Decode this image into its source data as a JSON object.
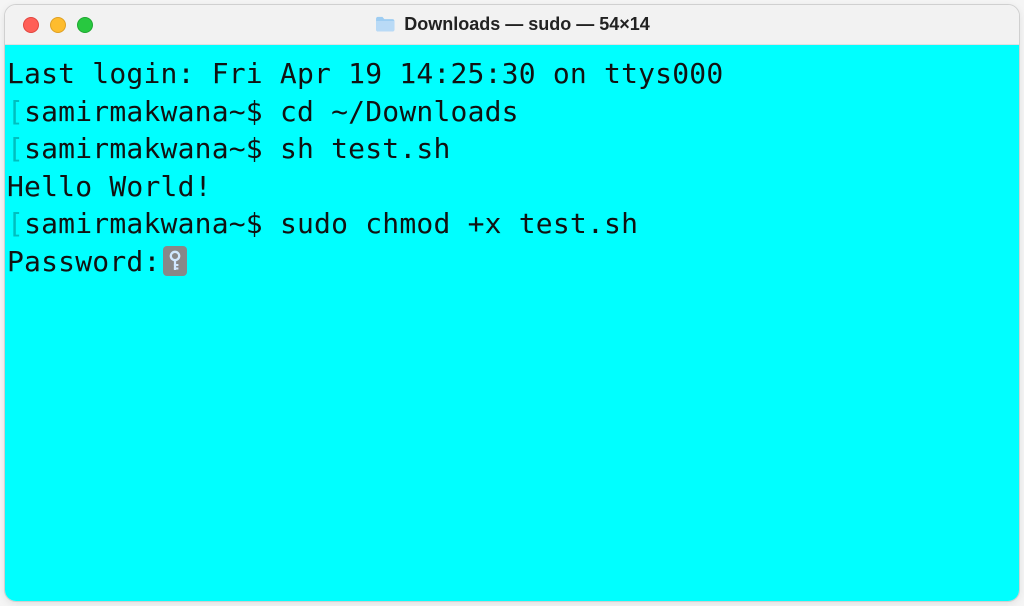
{
  "window": {
    "title": "Downloads — sudo — 54×14"
  },
  "terminal": {
    "colors": {
      "background": "#00ffff",
      "text": "#111111"
    },
    "last_login_line": "Last login: Fri Apr 19 14:25:30 on ttys000",
    "lines": [
      {
        "prefix": "[",
        "prompt": "samirmakwana~$ ",
        "command": "cd ~/Downloads"
      },
      {
        "prefix": "[",
        "prompt": "samirmakwana~$ ",
        "command": "sh test.sh"
      }
    ],
    "output_line": "Hello World!",
    "sudo_line": {
      "prefix": "[",
      "prompt": "samirmakwana~$ ",
      "command": "sudo chmod +x test.sh"
    },
    "password_label": "Password:",
    "password_icon": "key-icon"
  }
}
